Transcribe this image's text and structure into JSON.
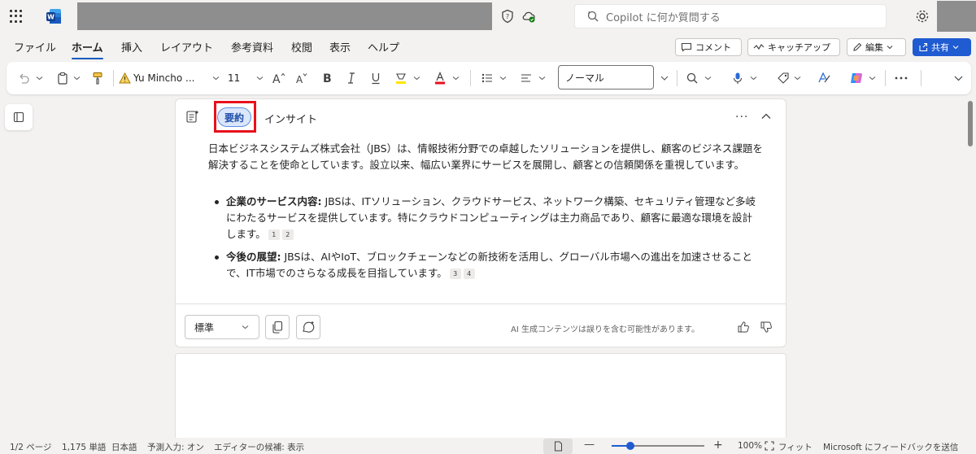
{
  "search": {
    "placeholder": "Copilot に何か質問する"
  },
  "menu": {
    "tabs": [
      "ファイル",
      "ホーム",
      "挿入",
      "レイアウト",
      "参考資料",
      "校閲",
      "表示",
      "ヘルプ"
    ],
    "active": "ホーム",
    "comment_label": "コメント",
    "catchup_label": "キャッチアップ",
    "edit_label": "編集",
    "share_label": "共有"
  },
  "toolbar": {
    "font_name": "Yu Mincho ...",
    "font_size": "11",
    "style_name": "ノーマル",
    "icons": [
      "undo-icon",
      "clipboard-icon",
      "format-painter-icon",
      "font-warning-icon",
      "grow-font-icon",
      "shrink-font-icon",
      "bold-icon",
      "italic-icon",
      "underline-icon",
      "highlighter-icon",
      "font-color-icon",
      "bullets-icon",
      "align-icon",
      "search-icon",
      "dictate-icon",
      "sensitivity-icon",
      "editor-icon",
      "copilot-icon",
      "more-icon",
      "expand-ribbon-icon"
    ]
  },
  "copilot_card": {
    "tab_summary": "要約",
    "tab_insight": "インサイト",
    "summary_text": "日本ビジネスシステムズ株式会社（JBS）は、情報技術分野での卓越したソリューションを提供し、顧客のビジネス課題を解決することを使命としています。設立以来、幅広い業界にサービスを展開し、顧客との信頼関係を重視しています。",
    "bullets": [
      {
        "title": "企業のサービス内容:",
        "text": " JBSは、ITソリューション、クラウドサービス、ネットワーク構築、セキュリティ管理など多岐にわたるサービスを提供しています。特にクラウドコンピューティングは主力商品であり、顧客に最適な環境を設計します。",
        "refs": [
          "1",
          "2"
        ]
      },
      {
        "title": "今後の展望:",
        "text": " JBSは、AIやIoT、ブロックチェーンなどの新技術を活用し、グローバル市場への進出を加速させることで、IT市場でのさらなる成長を目指しています。",
        "refs": [
          "3",
          "4"
        ]
      }
    ],
    "length_select": "標準",
    "disclaimer": "AI 生成コンテンツは誤りを含む可能性があります。"
  },
  "statusbar": {
    "page": "1/2 ページ",
    "words": "1,175 単語",
    "language": "日本語",
    "predictive": "予測入力: オン",
    "editor": "エディターの候補: 表示",
    "zoom": "100%",
    "fit": "フィット",
    "feedback": "Microsoft にフィードバックを送信"
  },
  "colors": {
    "accent": "#185abd",
    "share": "#1f5bd1",
    "highlight_box": "#e8101c"
  }
}
